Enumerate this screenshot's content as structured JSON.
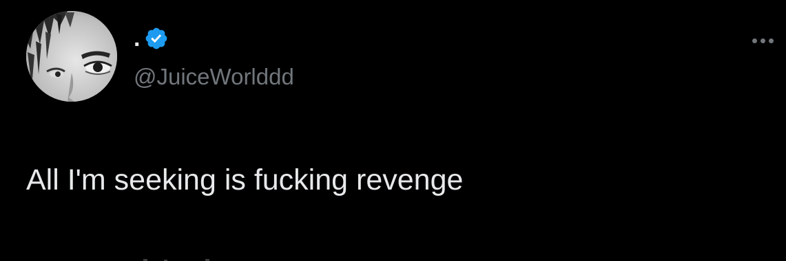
{
  "author": {
    "display_name": ".",
    "handle": "@JuiceWorlddd",
    "verified": true,
    "avatar_icon": "profile-photo"
  },
  "tweet": {
    "text": "All I'm seeking is fucking revenge"
  },
  "menu": {
    "more_icon": "more-horizontal-icon"
  },
  "colors": {
    "background": "#000000",
    "text_primary": "#e7e9ea",
    "text_secondary": "#71767b",
    "verified_badge": "#1d9bf0"
  }
}
